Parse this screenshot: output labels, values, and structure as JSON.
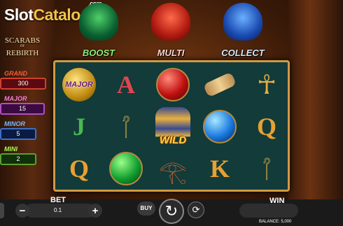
{
  "brand": {
    "part1": "Slot",
    "part2": "Catalog",
    "suffix": ".com"
  },
  "game_logo": {
    "line1": "SCARABS",
    "of": "OF",
    "line2": "REBIRTH"
  },
  "features": [
    {
      "label": "BOOST",
      "color": "#8ef07a"
    },
    {
      "label": "MULTI",
      "color": "#ffd8d0"
    },
    {
      "label": "COLLECT",
      "color": "#d8ecff"
    }
  ],
  "jackpots": {
    "grand": {
      "title": "GRAND",
      "value": "300"
    },
    "major": {
      "title": "MAJOR",
      "value": "15"
    },
    "minor": {
      "title": "MINOR",
      "value": "5"
    },
    "mini": {
      "title": "MINI",
      "value": "2"
    }
  },
  "reels": [
    [
      {
        "symbol": "coin-major",
        "text": "MAJOR"
      },
      {
        "symbol": "letter-J",
        "text": "J"
      },
      {
        "symbol": "letter-Q",
        "text": "Q"
      }
    ],
    [
      {
        "symbol": "letter-A",
        "text": "A"
      },
      {
        "symbol": "hieroglyph",
        "text": ""
      },
      {
        "symbol": "green-orb",
        "text": ""
      }
    ],
    [
      {
        "symbol": "red-orb",
        "text": ""
      },
      {
        "symbol": "pharaoh-wild",
        "text": "WILD"
      },
      {
        "symbol": "eye-of-horus",
        "text": ""
      }
    ],
    [
      {
        "symbol": "scroll",
        "text": ""
      },
      {
        "symbol": "blue-orb",
        "text": ""
      },
      {
        "symbol": "letter-K",
        "text": "K"
      }
    ],
    [
      {
        "symbol": "ankh",
        "text": ""
      },
      {
        "symbol": "letter-Q",
        "text": "Q"
      },
      {
        "symbol": "hieroglyph",
        "text": ""
      }
    ]
  ],
  "controls": {
    "bet_label": "BET",
    "bet_value": "0.1",
    "minus": "−",
    "plus": "+",
    "buy_label": "BUY",
    "win_label": "WIN",
    "balance": "BALANCE: 5,000"
  }
}
